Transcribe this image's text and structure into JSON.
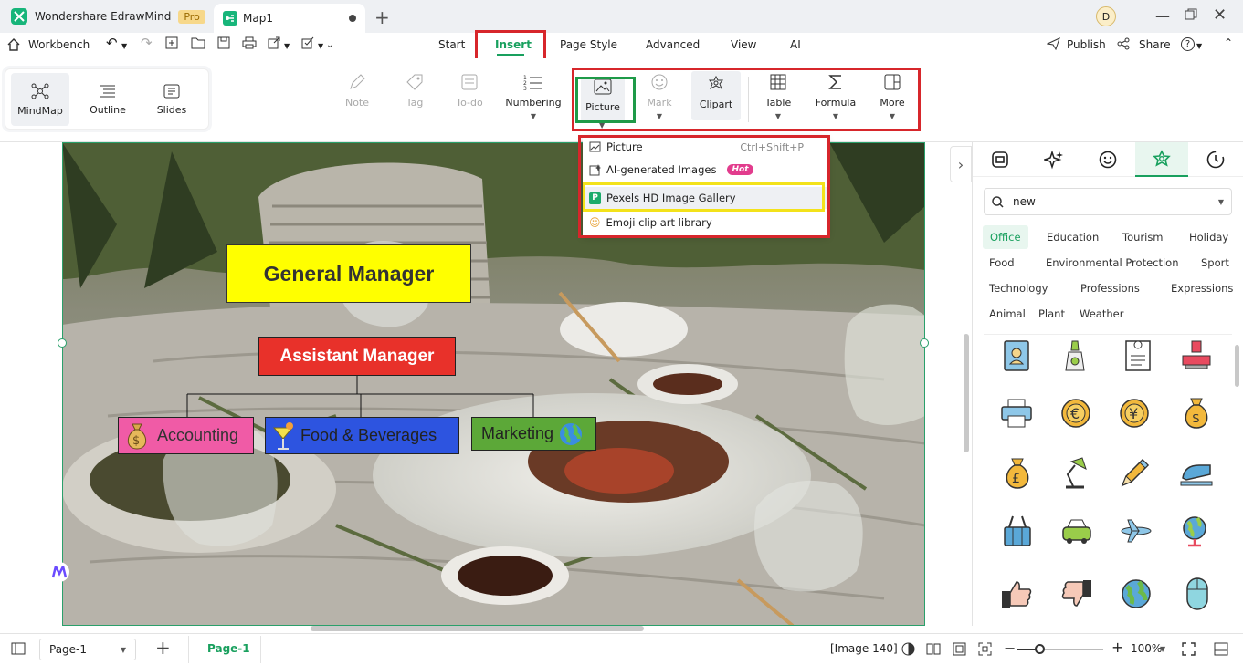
{
  "app": {
    "name": "Wondershare EdrawMind",
    "badge": "Pro",
    "avatar": "D"
  },
  "doc_tab": {
    "title": "Map1"
  },
  "menubar": {
    "workbench": "Workbench",
    "tabs": [
      "Start",
      "Insert",
      "Page Style",
      "Advanced",
      "View",
      "AI"
    ],
    "publish": "Publish",
    "share": "Share",
    "help": "?"
  },
  "views": [
    "MindMap",
    "Outline",
    "Slides"
  ],
  "ribbon": {
    "note": "Note",
    "tag": "Tag",
    "todo": "To-do",
    "numbering": "Numbering",
    "picture": "Picture",
    "mark": "Mark",
    "clipart": "Clipart",
    "table": "Table",
    "formula": "Formula",
    "more": "More"
  },
  "dropdown": {
    "picture": "Picture",
    "picture_shortcut": "Ctrl+Shift+P",
    "ai_images": "AI-generated Images",
    "hot": "Hot",
    "pexels": "Pexels HD Image Gallery",
    "emoji": "Emoji clip art library"
  },
  "mindmap": {
    "general_manager": "General Manager",
    "assistant_manager": "Assistant Manager",
    "accounting": "Accounting",
    "food": "Food & Beverages",
    "marketing": "Marketing",
    "colors": {
      "gm": "#ffff00",
      "am": "#e8312a",
      "acc": "#f05ba6",
      "food": "#2d54e0",
      "mkt": "#5ca838"
    }
  },
  "panel": {
    "search_value": "new",
    "categories": [
      "Office",
      "Education",
      "Tourism",
      "Holiday",
      "Food",
      "Environmental Protection",
      "Sport",
      "Technology",
      "Professions",
      "Expressions",
      "Animal",
      "Plant",
      "Weather"
    ],
    "active_category": "Office",
    "icons": [
      "id-badge-icon",
      "glue-icon",
      "document-icon",
      "stamp-icon",
      "printer-icon",
      "euro-coin-icon",
      "yen-coin-icon",
      "dollar-bag-icon",
      "pound-bag-icon",
      "desk-lamp-icon",
      "pencil-icon",
      "stapler-icon",
      "binder-clip-icon",
      "car-icon",
      "airplane-icon",
      "globe-icon",
      "thumbs-up-icon",
      "thumbs-down-icon",
      "earth-icon",
      "mouse-icon"
    ]
  },
  "statusbar": {
    "page_select": "Page-1",
    "page_tab": "Page-1",
    "image_info": "[Image 140]",
    "zoom": "100%"
  }
}
